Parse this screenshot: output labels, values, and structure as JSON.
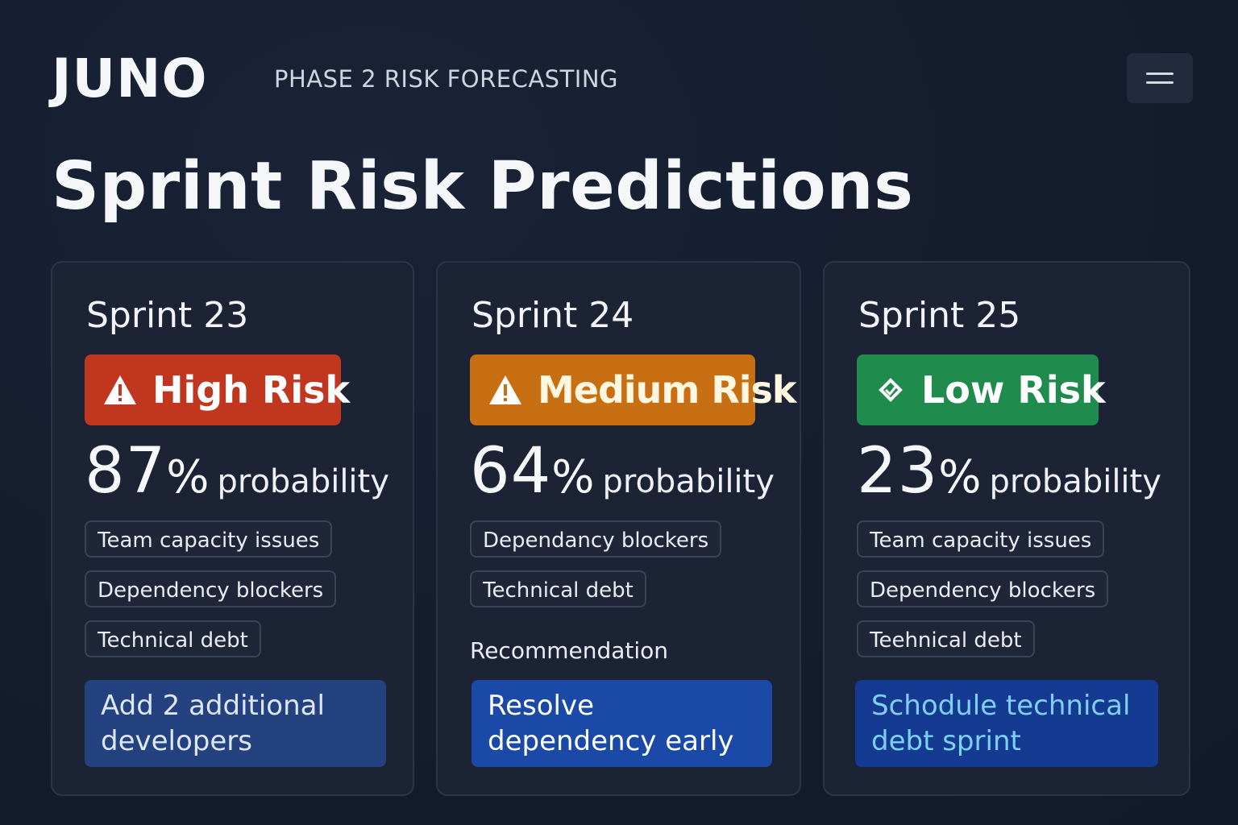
{
  "header": {
    "brand": "JUNO",
    "subtitle": "PHASE 2 RISK FORECASTING",
    "menu_icon": "hamburger-menu-icon"
  },
  "page_title": "Sprint Risk Predictions",
  "colors": {
    "background": "#141c2d",
    "card": "#1b2335",
    "high_risk": "#c0361f",
    "medium_risk": "#c86f14",
    "low_risk": "#1f8c4d",
    "recommendation": "#1a49a8"
  },
  "sprints": [
    {
      "name": "Sprint 23",
      "risk_level": "High Risk",
      "risk_icon": "warning-triangle-icon",
      "probability_value": "87",
      "probability_unit": "%",
      "probability_word": "probability",
      "factors": [
        "Team capacity issues",
        "Dependency blockers",
        "Technical debt"
      ],
      "recommendation_label": "",
      "recommendation": "Add 2 additional developers"
    },
    {
      "name": "Sprint 24",
      "risk_level": "Medium Risk",
      "risk_icon": "warning-triangle-icon",
      "probability_value": "64",
      "probability_unit": "%",
      "probability_word": "probability",
      "factors": [
        "Dependancy blockers",
        "Technical debt"
      ],
      "recommendation_label": "Recommendation",
      "recommendation": "Resolve dependency early"
    },
    {
      "name": "Sprint 25",
      "risk_level": "Low Risk",
      "risk_icon": "diamond-check-icon",
      "probability_value": "23",
      "probability_unit": "%",
      "probability_word": "probability",
      "factors": [
        "Team capacity issues",
        "Dependency blockers",
        "Teehnical debt"
      ],
      "recommendation_label": "",
      "recommendation": "Schodule technical debt sprint"
    }
  ]
}
